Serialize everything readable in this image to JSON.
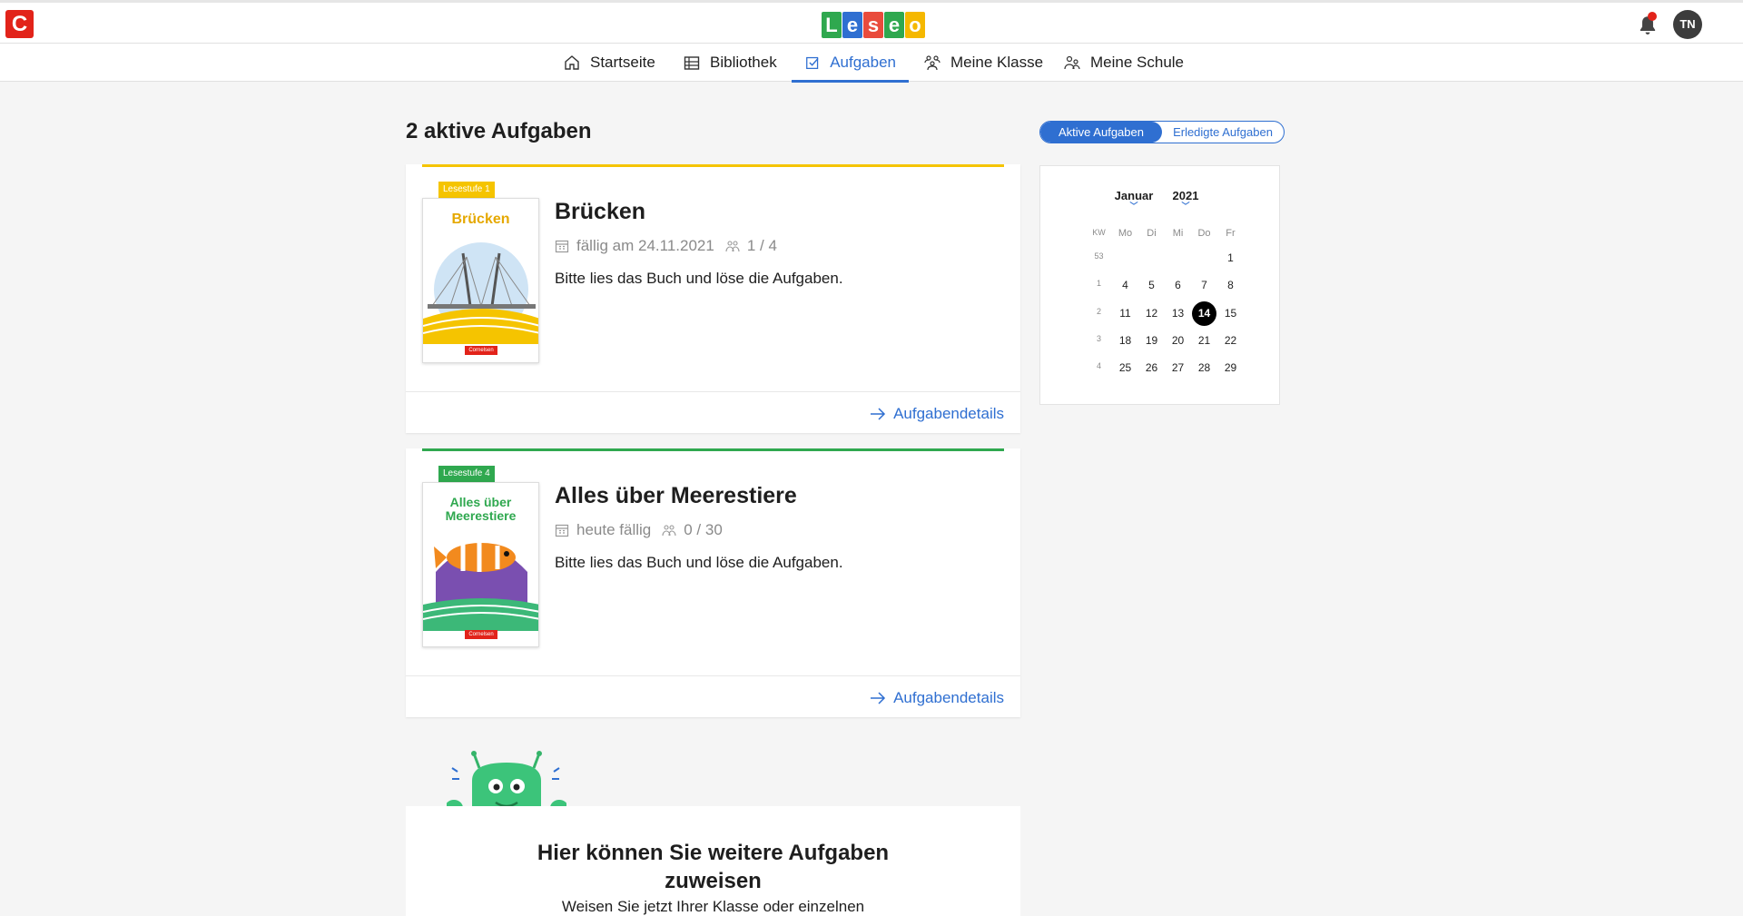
{
  "brand": {
    "c_letter": "C",
    "leseo_letters": [
      "L",
      "e",
      "s",
      "e",
      "o"
    ],
    "leseo_colors": [
      "#2fa84f",
      "#2f6fd1",
      "#e94b3c",
      "#2fa84f",
      "#f5b800"
    ]
  },
  "user": {
    "initials": "TN"
  },
  "nav": [
    {
      "label": "Startseite",
      "icon": "home-icon"
    },
    {
      "label": "Bibliothek",
      "icon": "library-icon"
    },
    {
      "label": "Aufgaben",
      "icon": "task-icon",
      "active": true
    },
    {
      "label": "Meine Klasse",
      "icon": "class-icon"
    },
    {
      "label": "Meine Schule",
      "icon": "school-icon"
    }
  ],
  "page": {
    "title": "2 aktive Aufgaben"
  },
  "toggle": {
    "active_label": "Aktive Aufgaben",
    "done_label": "Erledigte Aufgaben"
  },
  "tasks": [
    {
      "level": "Lesestufe 1",
      "level_color": "#f5c400",
      "cover_title": "Brücken",
      "title": "Brücken",
      "due": "fällig am 24.11.2021",
      "progress": "1 / 4",
      "description": "Bitte lies das Buch und löse die Aufgaben.",
      "details": "Aufgabendetails"
    },
    {
      "level": "Lesestufe 4",
      "level_color": "#2fa84f",
      "cover_title_line1": "Alles über",
      "cover_title_line2": "Meerestiere",
      "title": "Alles über Meerestiere",
      "due": "heute fällig",
      "progress": "0 / 30",
      "description": "Bitte lies das Buch und löse die Aufgaben.",
      "details": "Aufgabendetails"
    }
  ],
  "calendar": {
    "month": "Januar",
    "year": "2021",
    "headers": [
      "KW",
      "Mo",
      "Di",
      "Mi",
      "Do",
      "Fr"
    ],
    "rows": [
      [
        "53",
        "",
        "",
        "",
        "",
        "1"
      ],
      [
        "1",
        "4",
        "5",
        "6",
        "7",
        "8"
      ],
      [
        "2",
        "11",
        "12",
        "13",
        "14",
        "15"
      ],
      [
        "3",
        "18",
        "19",
        "20",
        "21",
        "22"
      ],
      [
        "4",
        "25",
        "26",
        "27",
        "28",
        "29"
      ]
    ],
    "today": "14"
  },
  "promo": {
    "title_line1": "Hier können Sie weitere Aufgaben",
    "title_line2": "zuweisen",
    "text": "Weisen Sie jetzt Ihrer Klasse oder einzelnen"
  }
}
